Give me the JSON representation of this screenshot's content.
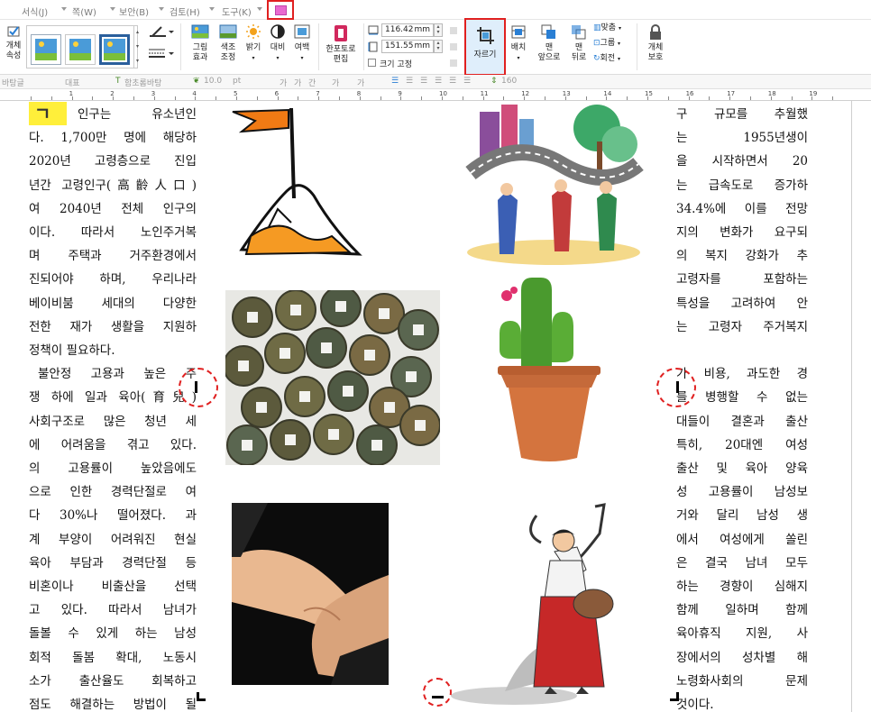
{
  "menubar": {
    "items": [
      "서식(J)",
      "쪽(W)",
      "보안(B)",
      "검토(H)",
      "도구(K)"
    ]
  },
  "ribbon": {
    "object_property_label": "개체\n속성",
    "picture_effect_label": "그림\n효과",
    "color_adjust_label": "색조\n조정",
    "brightness_label": "밝기",
    "contrast_label": "대비",
    "margin_label": "여백",
    "hancom_toolbox_label": "한포토로\n편집",
    "width_value": "116.42",
    "height_value": "151.55",
    "unit": "mm",
    "fix_size_label": "크기 고정",
    "crop_label": "자르기",
    "arrange_label": "배치",
    "bring_front_label": "맨\n앞으로",
    "send_back_label": "맨\n뒤로",
    "align_label": "맞춤",
    "group_label": "그룹",
    "rotate_label": "회전",
    "object_protect_label": "개체\n보호"
  },
  "formatbar": {
    "style": "바탕글",
    "para": "대표",
    "font": "함초롬바탕",
    "size": "10.0",
    "size_unit": "pt",
    "spacing": "160"
  },
  "ruler": {
    "numbers": [
      "1",
      "2",
      "3",
      "4",
      "5",
      "6",
      "7",
      "8",
      "9",
      "10",
      "11",
      "12",
      "13",
      "14",
      "15",
      "16",
      "17",
      "18",
      "19"
    ]
  },
  "doc": {
    "dropcap": "ㄱ",
    "left_lines": [
      "인구는 유소년인",
      "다. 1,700만 명에 해당하",
      "2020년 고령층으로 진입",
      "년간 고령인구(高齡人口)",
      "여 2040년 전체 인구의",
      "이다. 따라서 노인주거복",
      "며 주택과 거주환경에서",
      "진되어야 하며, 우리나라",
      "베이비붐 세대의 다양한",
      "전한 재가 생활을 지원하",
      "정책이 필요하다.",
      "불안정 고용과 높은 주",
      "쟁 하에 일과 육아(育兒)",
      "사회구조로 많은 청년 세",
      "에 어려움을 겪고 있다.",
      "의 고용률이 높았음에도",
      "으로 인한 경력단절로 여",
      "다 30%나 떨어졌다. 과",
      "계 부양이 어려워진 현실",
      "육아 부담과 경력단절 등",
      "비혼이나 비출산을 선택",
      "고 있다. 따라서 남녀가",
      "돌볼 수 있게 하는 남성",
      "회적 돌봄 확대, 노동시",
      "소가 출산율도 회복하고",
      "점도 해결하는 방법이 될"
    ],
    "right_lines": [
      "구 규모를 추월했",
      "는 1955년생이",
      "을 시작하면서 20",
      "는 급속도로 증가하",
      "34.4%에 이를 전망",
      "지의 변화가 요구되",
      "의 복지 강화가 추",
      "고령자를 포함하는",
      "특성을 고려하여 안",
      "는 고령자 주거복지",
      "",
      "가 비용, 과도한 경",
      "를 병행할 수 없는",
      "대들이 결혼과 출산",
      "특히, 20대엔 여성",
      "출산 및 육아 양육",
      "성 고용률이 남성보",
      "거와 달리 남성 생",
      "에서 여성에게 쏠린",
      "은 결국 남녀 모두",
      "하는 경향이 심해지",
      "함께 일하며 함께",
      "육아휴직 지원, 사",
      "장에서의 성차별 해",
      "노령화사회의 문제",
      "것이다."
    ]
  },
  "colors": {
    "accent_red": "#e02020",
    "dropcap_yellow": "#ffef3a",
    "crop_selected_bg": "#dfeefb"
  }
}
